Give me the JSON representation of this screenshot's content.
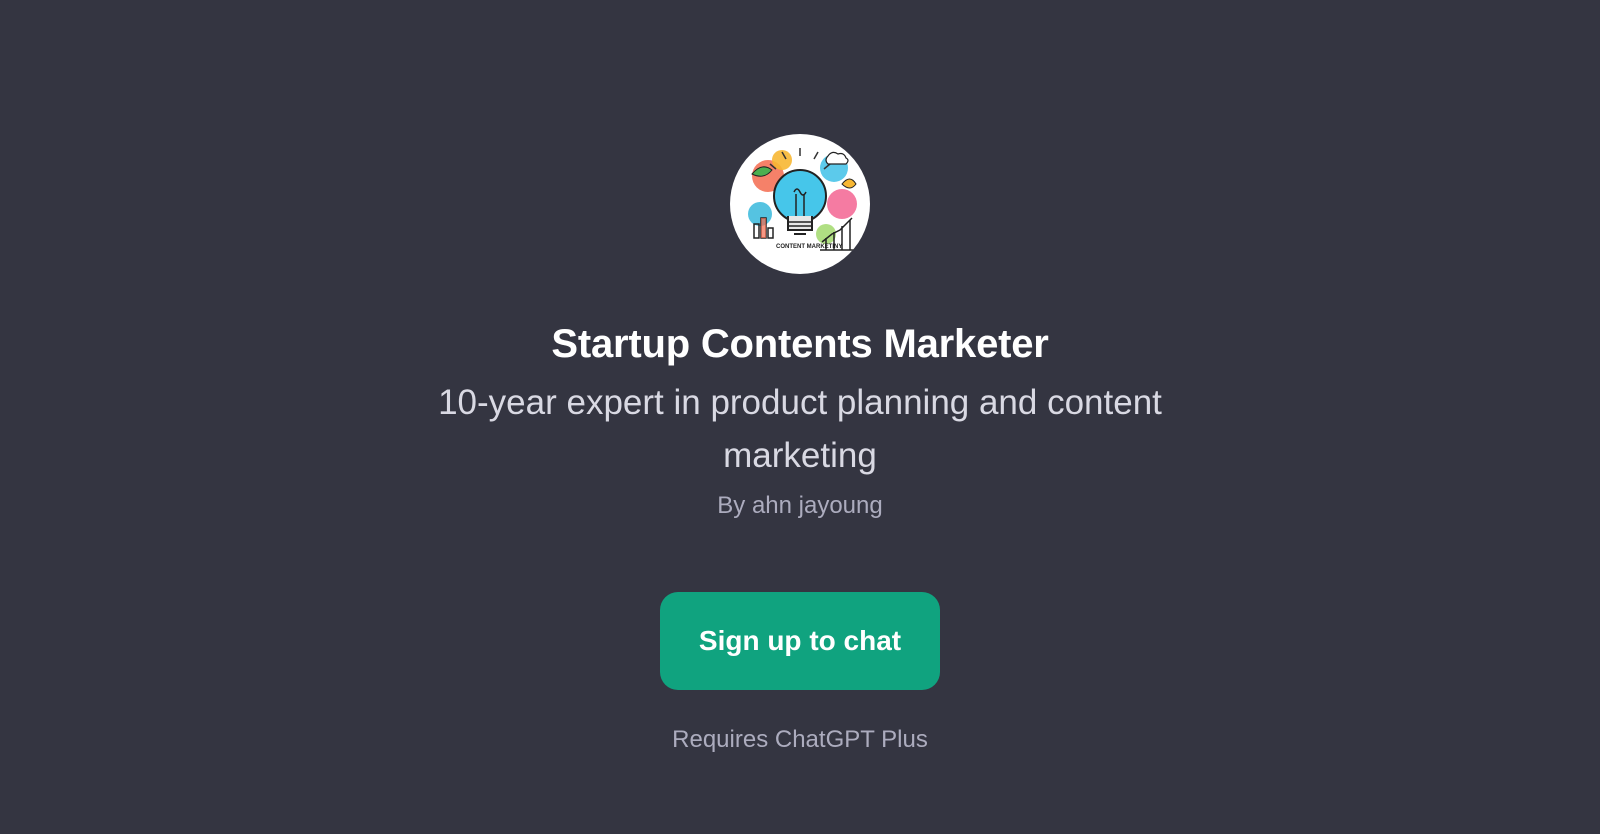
{
  "gpt": {
    "avatar_icon": "lightbulb-content-marketing-illustration-icon",
    "avatar_text": "CONTENT MARKETINY",
    "title": "Startup Contents Marketer",
    "description": "10-year expert in product planning and content marketing",
    "author": "By ahn jayoung"
  },
  "actions": {
    "signup_label": "Sign up to chat",
    "requirement_note": "Requires ChatGPT Plus"
  },
  "colors": {
    "background": "#343541",
    "button": "#10a37f",
    "title": "#ffffff",
    "subtitle": "#d9d9e3",
    "muted": "#acacbe"
  }
}
